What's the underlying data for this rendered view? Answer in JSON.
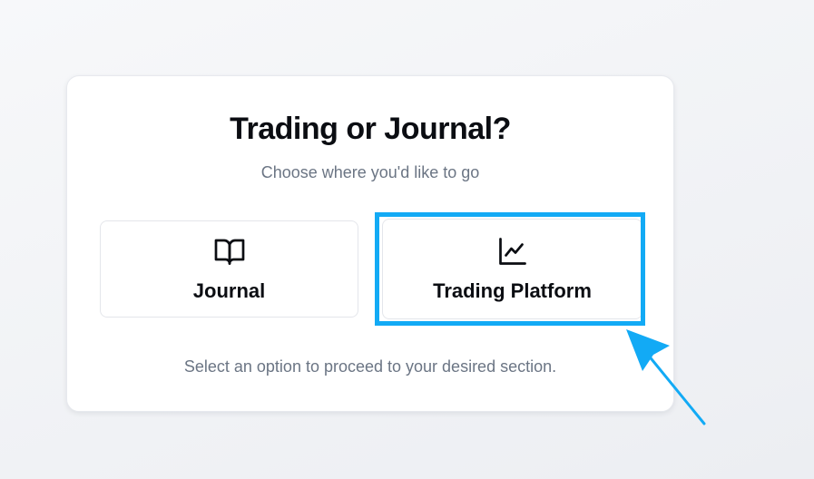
{
  "dialog": {
    "title": "Trading or Journal?",
    "subtitle": "Choose where you'd like to go",
    "options": [
      {
        "label": "Journal",
        "icon": "open-book-icon"
      },
      {
        "label": "Trading Platform",
        "icon": "line-chart-icon"
      }
    ],
    "footer": "Select an option to proceed to your desired section."
  },
  "annotation": {
    "highlight_color": "#12aaf5",
    "target": "Trading Platform"
  }
}
